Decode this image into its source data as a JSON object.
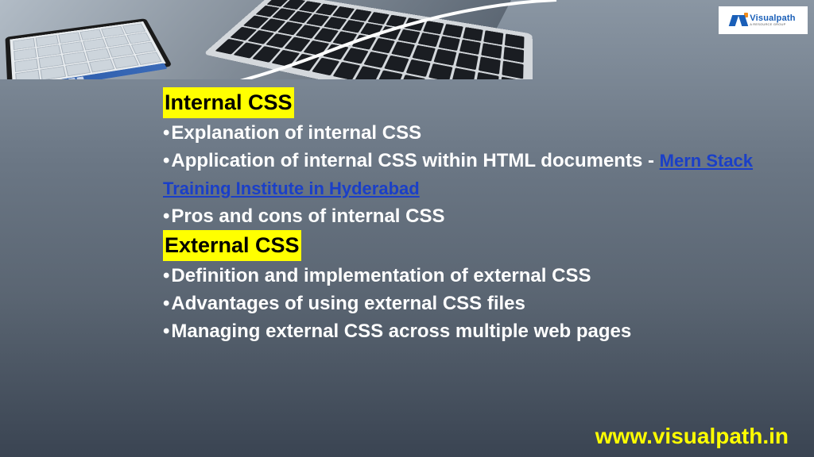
{
  "logo": {
    "name": "Visualpath",
    "tagline": "A RESOURCE GROUP"
  },
  "section1": {
    "heading": "Internal CSS",
    "bullet1": "Explanation of internal CSS",
    "bullet2_prefix": "Application of internal CSS within HTML documents    - ",
    "bullet2_link": "Mern Stack Training Institute in Hyderabad",
    "bullet3": "Pros and cons of internal CSS"
  },
  "section2": {
    "heading": "External CSS",
    "bullet1": "Definition and implementation of external CSS",
    "bullet2": "Advantages of using external CSS files",
    "bullet3": "Managing external CSS across multiple web pages"
  },
  "footer": {
    "url": "www.visualpath.in"
  }
}
